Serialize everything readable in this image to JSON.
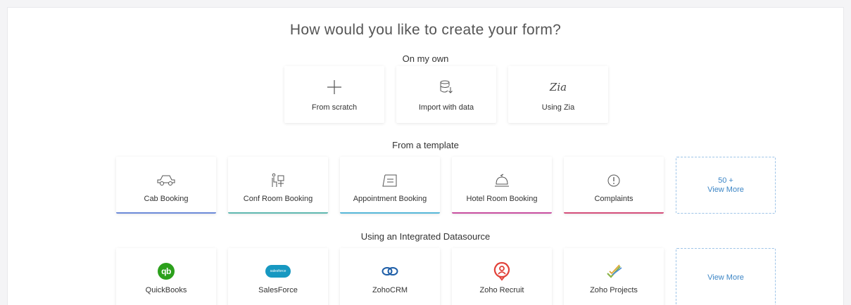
{
  "header": {
    "title": "How would you like to create your form?"
  },
  "own": {
    "title": "On my own",
    "items": [
      {
        "label": "From scratch",
        "icon": "plus-icon"
      },
      {
        "label": "Import with data",
        "icon": "database-import-icon"
      },
      {
        "label": "Using Zia",
        "icon": "zia-icon",
        "icon_text": "Zia"
      }
    ]
  },
  "templates": {
    "title": "From a template",
    "items": [
      {
        "label": "Cab Booking",
        "icon": "car-icon",
        "color": "#6c8ad8"
      },
      {
        "label": "Conf Room Booking",
        "icon": "chair-icon",
        "color": "#5fb8b0"
      },
      {
        "label": "Appointment Booking",
        "icon": "calendar-icon",
        "color": "#56b7d8"
      },
      {
        "label": "Hotel Room Booking",
        "icon": "service-bell-icon",
        "color": "#c84fa0"
      },
      {
        "label": "Complaints",
        "icon": "alert-circle-icon",
        "color": "#d44e7a"
      }
    ],
    "more": {
      "count": "50 +",
      "label": "View More"
    }
  },
  "datasources": {
    "title": "Using an Integrated Datasource",
    "items": [
      {
        "label": "QuickBooks",
        "icon": "quickbooks-icon",
        "color": "#2ca01c",
        "icon_text": "qb"
      },
      {
        "label": "SalesForce",
        "icon": "salesforce-icon",
        "color": "#1798c1",
        "icon_text": "salesforce"
      },
      {
        "label": "ZohoCRM",
        "icon": "zohocrm-icon",
        "color": "#1f5fa8"
      },
      {
        "label": "Zoho Recruit",
        "icon": "zoho-recruit-icon",
        "color": "#e2433b"
      },
      {
        "label": "Zoho Projects",
        "icon": "zoho-projects-icon",
        "color": "#8ab34a"
      }
    ],
    "more": {
      "label": "View More"
    }
  },
  "colors": {
    "accent": "#3d86c6",
    "dashed_border": "#9ec4e8"
  }
}
